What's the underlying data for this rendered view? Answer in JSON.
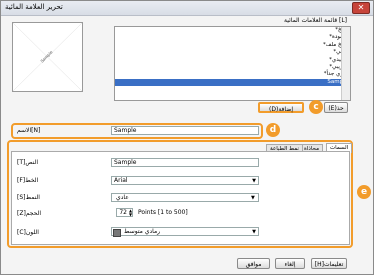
{
  "window": {
    "title": "تحرير العلامة المائية",
    "close_glyph": "✕"
  },
  "preview": {
    "watermark_text": "Sample"
  },
  "watermark_list": {
    "label": "[L] قائمة العلامات المائية",
    "items": [
      "نسخ*",
      "مسودة*",
      "نسخ ملف*",
      "نهائي*",
      "تمهيدي*",
      "تجريبي*",
      "سري جداً*",
      "Sample"
    ],
    "selected": "Sample"
  },
  "buttons": {
    "add": "(D)إضافة",
    "delete": "(E)حذ",
    "ok": "موافق",
    "cancel": "إلغاء",
    "help": "[H]تعليمات"
  },
  "callouts": {
    "c": "c",
    "d": "d",
    "e": "e"
  },
  "name_field": {
    "label": "الاسم[N]",
    "value": "Sample"
  },
  "tabs": [
    {
      "label": "السمات"
    },
    {
      "label": "محاذاة"
    },
    {
      "label": "نمط الطباعة"
    }
  ],
  "attributes": {
    "text": {
      "label": "النص[T]",
      "value": "Sample"
    },
    "font": {
      "label": "الخط[F]",
      "value": "Arial"
    },
    "style": {
      "label": "النمط[S]",
      "value": "عادي"
    },
    "size": {
      "label": "الحجم[Z]",
      "value": "72",
      "units": "Points [1 to 500]"
    },
    "color": {
      "label": "اللون[C]",
      "value": "رمادي متوسط",
      "swatch": "#777777"
    }
  },
  "colors": {
    "accent": "#f29c2b",
    "selection": "#3a6fc5"
  }
}
